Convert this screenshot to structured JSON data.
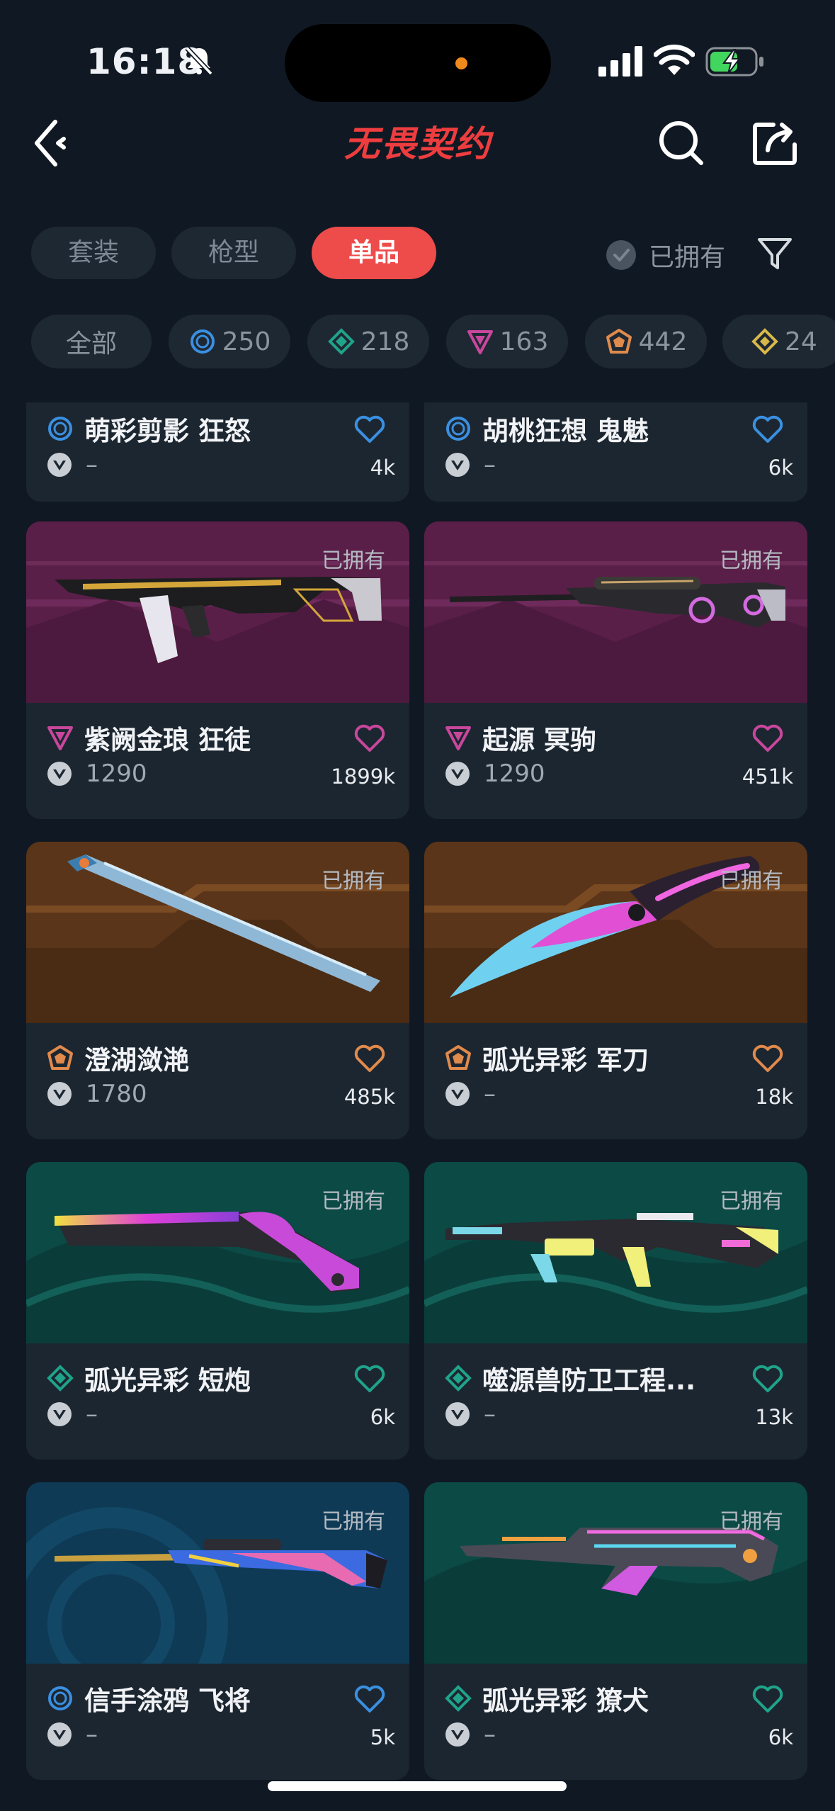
{
  "status_bar": {
    "time": "16:18"
  },
  "header": {
    "logo_text": "无畏契约"
  },
  "tabs": [
    {
      "label": "套装",
      "active": false
    },
    {
      "label": "枪型",
      "active": false
    },
    {
      "label": "单品",
      "active": true
    }
  ],
  "owned_filter": {
    "label": "已拥有"
  },
  "tier_chips": [
    {
      "label": "全部",
      "tier": "all"
    },
    {
      "label": "250",
      "tier": "select",
      "color": "#3a8fe0"
    },
    {
      "label": "218",
      "tier": "deluxe",
      "color": "#1fa38a"
    },
    {
      "label": "163",
      "tier": "premium",
      "color": "#c8479c"
    },
    {
      "label": "442",
      "tier": "exclusive",
      "color": "#e08a4c"
    },
    {
      "label": "24",
      "tier": "ultra",
      "color": "#d9b84a"
    }
  ],
  "colors": {
    "accent": "#ee4b4b",
    "background": "#101923",
    "card": "#1c2630"
  },
  "items": [
    {
      "name": "萌彩剪影 狂怒",
      "tier": "select",
      "price": "–",
      "likes": "4k",
      "owned": false
    },
    {
      "name": "胡桃狂想 鬼魅",
      "tier": "select",
      "price": "–",
      "likes": "6k",
      "owned": false
    },
    {
      "name": "紫阙金琅 狂徒",
      "tier": "premium",
      "price": "1290",
      "likes": "1899k",
      "owned": true,
      "owned_label": "已拥有"
    },
    {
      "name": "起源 冥驹",
      "tier": "premium",
      "price": "1290",
      "likes": "451k",
      "owned": true,
      "owned_label": "已拥有"
    },
    {
      "name": "澄湖潋滟",
      "tier": "exclusive",
      "price": "1780",
      "likes": "485k",
      "owned": true,
      "owned_label": "已拥有"
    },
    {
      "name": "弧光异彩 军刀",
      "tier": "exclusive",
      "price": "–",
      "likes": "18k",
      "owned": true,
      "owned_label": "已拥有"
    },
    {
      "name": "弧光异彩 短炮",
      "tier": "deluxe",
      "price": "–",
      "likes": "6k",
      "owned": true,
      "owned_label": "已拥有"
    },
    {
      "name": "噬源兽防卫工程...",
      "tier": "deluxe",
      "price": "–",
      "likes": "13k",
      "owned": true,
      "owned_label": "已拥有"
    },
    {
      "name": "信手涂鸦 飞将",
      "tier": "select",
      "price": "–",
      "likes": "5k",
      "owned": true,
      "owned_label": "已拥有"
    },
    {
      "name": "弧光异彩 獠犬",
      "tier": "deluxe",
      "price": "–",
      "likes": "6k",
      "owned": true,
      "owned_label": "已拥有"
    }
  ]
}
